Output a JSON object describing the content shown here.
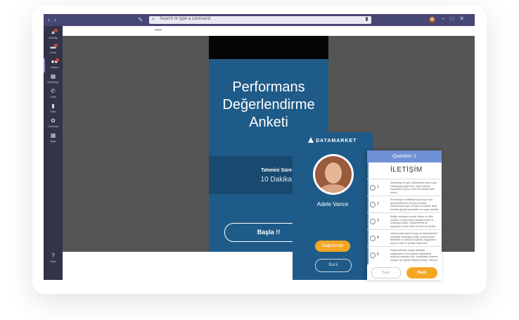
{
  "titlebar": {
    "search_placeholder": "Search or type a command",
    "nav_icons": [
      "back-arrow-icon",
      "forward-arrow-icon"
    ],
    "window_buttons": [
      "minimize-icon",
      "maximize-icon",
      "close-icon"
    ]
  },
  "rail": {
    "items": [
      {
        "label": "Activity",
        "icon": "bell-icon",
        "badge": true
      },
      {
        "label": "Chat",
        "icon": "chat-icon",
        "badge": true
      },
      {
        "label": "Teams",
        "icon": "teams-icon",
        "badge": true,
        "active": true
      },
      {
        "label": "Meetings",
        "icon": "calendar-icon"
      },
      {
        "label": "Calls",
        "icon": "phone-icon"
      },
      {
        "label": "Files",
        "icon": "file-icon"
      },
      {
        "label": "Certiosis",
        "icon": "flower-icon"
      },
      {
        "label": "Apps",
        "icon": "apps-icon"
      }
    ],
    "help_label": "Help"
  },
  "survey": {
    "title": "Performans Değerlendirme Anketi",
    "duration_label": "Tahmini Süre",
    "duration_value": "10 Dakika",
    "start_button": "Başla !!"
  },
  "profile_phone": {
    "brand": "DATAMARKET",
    "person_name": "Adele Vance",
    "rate_button": "Değerlendir",
    "back_button": "Back"
  },
  "question_phone": {
    "header": "Question 1",
    "category": "İLETİŞİM",
    "questions": [
      {
        "num": "1",
        "text": "Emirlerlaya ve göz özlülemede bulunmuya Gasasayığı gözlemler; Düşüncelerini duygularını açık ve etkin bir şekilde ifade etmez."
      },
      {
        "num": "2",
        "text": "Emirlerlaya ve iletileşim kurmuşun bazı görüşümlülemle; Gurunu belirtilen düşüncelerini açık ve etkin bir şekilde ifade etmekte güçlük yaşmaktan ve uygun şekilde ifade edebilir."
      },
      {
        "num": "3",
        "text": "İletişim araçlarını seçme düzey ve etkin kurallar: Kul pencilerin dikkatle dinler ve anlamaya çalışır. Düşüncelerini ve duygularını ifade etme ve etkin bir şekilde ifade eder."
      },
      {
        "num": "4",
        "text": "Karşısındaki kişinin duygu ve düşüncelerini empatiyle anlamaya çalışır, duruma göre iletişimini ve üslubunu ayarlar; duygularını açık ve etkin bir şekilde ifade eder."
      },
      {
        "num": "5",
        "text": "Düşüncelerinde ekipte etkileşim çalışmalarını hem kişilerle ilişkilerinde açıklıkla rehberlik eder. Karşıdakini dinleme, anlaşılır bir şekilde iletişimi yönetir. Takımın iletişim etkinliğini ve etkin bir şekilde geliştirir."
      }
    ],
    "back_button": "Back",
    "next_button": "Next"
  }
}
